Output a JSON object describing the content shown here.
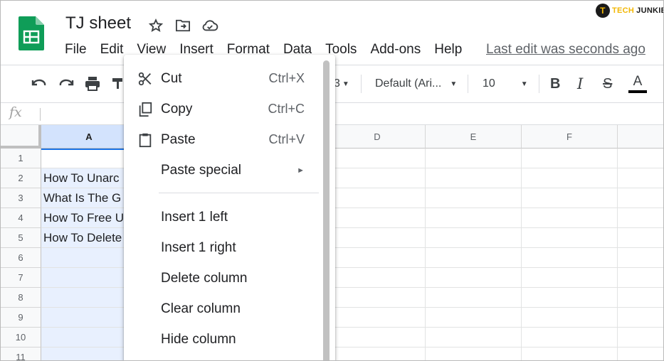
{
  "watermark": {
    "badge": "T",
    "text_a": "TECH",
    "text_b": "JUNKIE"
  },
  "doc": {
    "title": "TJ sheet"
  },
  "title_icons": [
    "star-icon",
    "move-to-folder-icon",
    "cloud-saved-icon"
  ],
  "menu": [
    {
      "label": "File"
    },
    {
      "label": "Edit"
    },
    {
      "label": "View"
    },
    {
      "label": "Insert"
    },
    {
      "label": "Format"
    },
    {
      "label": "Data"
    },
    {
      "label": "Tools"
    },
    {
      "label": "Add-ons"
    },
    {
      "label": "Help"
    }
  ],
  "last_edit": "Last edit was seconds ago",
  "toolbar": {
    "font_size_partial": "3",
    "font_family": "Default (Ari...",
    "font_size": "10",
    "bold": "B",
    "italic": "I",
    "strike": "S",
    "text_color": "A"
  },
  "formula": {
    "fx": "fx",
    "value": ""
  },
  "grid": {
    "columns": [
      {
        "label": "A"
      },
      {
        "label": "D"
      },
      {
        "label": "E"
      },
      {
        "label": "F"
      }
    ],
    "rows": [
      {
        "num": "1",
        "a": ""
      },
      {
        "num": "2",
        "a": "How To Unarc"
      },
      {
        "num": "3",
        "a": "What Is The G"
      },
      {
        "num": "4",
        "a": "How To Free U"
      },
      {
        "num": "5",
        "a": "How To Delete"
      },
      {
        "num": "6",
        "a": ""
      },
      {
        "num": "7",
        "a": ""
      },
      {
        "num": "8",
        "a": ""
      },
      {
        "num": "9",
        "a": ""
      },
      {
        "num": "10",
        "a": ""
      },
      {
        "num": "11",
        "a": ""
      }
    ]
  },
  "context_menu": {
    "items": [
      {
        "label": "Cut",
        "shortcut": "Ctrl+X",
        "icon": "scissors-icon"
      },
      {
        "label": "Copy",
        "shortcut": "Ctrl+C",
        "icon": "copy-icon"
      },
      {
        "label": "Paste",
        "shortcut": "Ctrl+V",
        "icon": "clipboard-icon"
      },
      {
        "label": "Paste special",
        "submenu_arrow": "►"
      },
      {
        "label": "Insert 1 left"
      },
      {
        "label": "Insert 1 right"
      },
      {
        "label": "Delete column"
      },
      {
        "label": "Clear column"
      },
      {
        "label": "Hide column"
      }
    ]
  },
  "colors": {
    "accent": "#1a73e8",
    "selection": "#e8f0fe",
    "sheets_green": "#0f9d58"
  }
}
